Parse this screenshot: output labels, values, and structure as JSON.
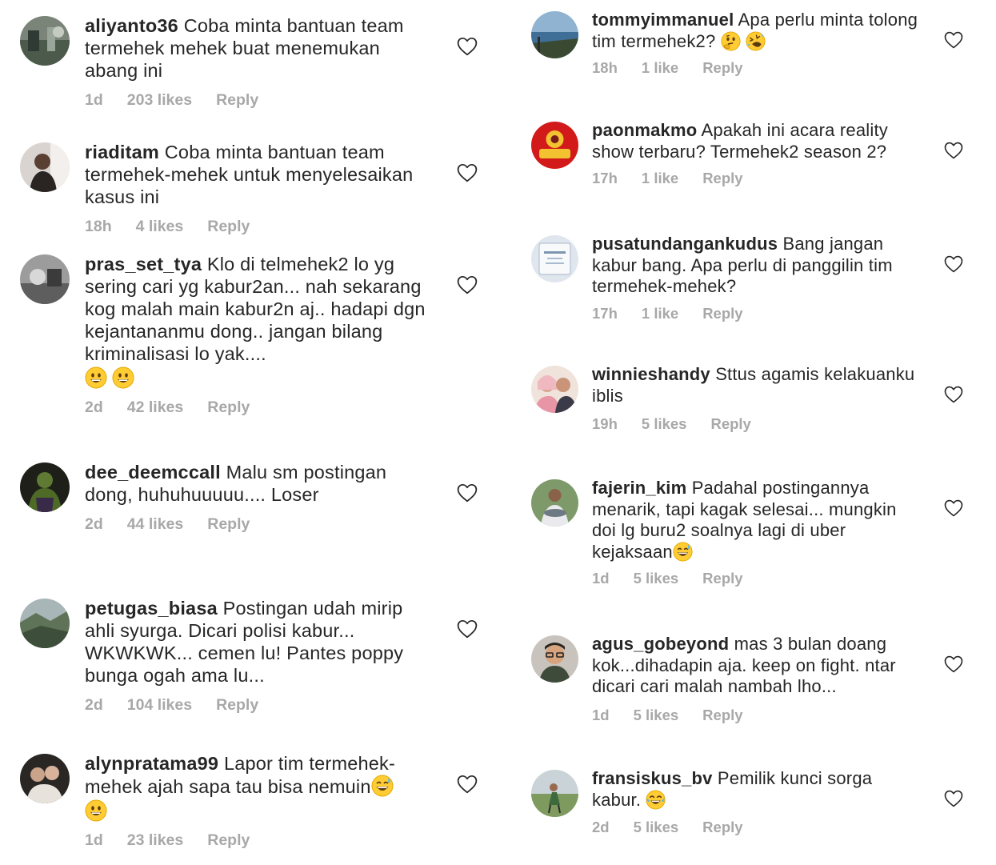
{
  "colors": {
    "text": "#262626",
    "meta": "#a8a8a8",
    "heart_stroke": "#262626",
    "emoji_fill": "#ffcc33"
  },
  "left_comments": [
    {
      "username": "aliyanto36",
      "text": "Coba minta bantuan team termehek mehek buat menemukan abang ini",
      "time": "1d",
      "likes": "203 likes",
      "reply": "Reply",
      "avatar_icon": "landscape-photo-avatar"
    },
    {
      "username": "riaditam",
      "text": "Coba minta bantuan team termehek-mehek untuk menyelesaikan kasus ini",
      "time": "18h",
      "likes": "4 likes",
      "reply": "Reply",
      "avatar_icon": "selfie-photo-avatar"
    },
    {
      "username": "pras_set_tya",
      "text": "Klo di telmehek2 lo yg sering cari yg kabur2an... nah sekarang kog malah main kabur2n aj.. hadapi dgn kejantananmu dong.. jangan bilang kriminalisasi lo yak....",
      "time": "2d",
      "likes": "42 likes",
      "reply": "Reply",
      "avatar_icon": "grayscale-photo-avatar",
      "emojis": [
        "grinning-face-emoji",
        "grinning-face-emoji"
      ]
    },
    {
      "username": "dee_deemccall",
      "text": "Malu sm postingan dong, huhuhuuuuu.... Loser",
      "time": "2d",
      "likes": "44 likes",
      "reply": "Reply",
      "avatar_icon": "hulk-figure-avatar"
    },
    {
      "username": "petugas_biasa",
      "text": "Postingan udah mirip ahli syurga. Dicari polisi kabur... WKWKWK... cemen lu! Pantes poppy bunga ogah ama lu...",
      "time": "2d",
      "likes": "104 likes",
      "reply": "Reply",
      "avatar_icon": "valley-landscape-avatar"
    },
    {
      "username": "alynpratama99",
      "text": "Lapor tim termehek-mehek ajah sapa tau bisa nemuin",
      "time": "1d",
      "likes": "23 likes",
      "reply": "Reply",
      "avatar_icon": "couple-photo-avatar",
      "inline_emoji": "grinning-sweat-emoji",
      "emojis": [
        "grinning-face-emoji"
      ]
    }
  ],
  "right_comments": [
    {
      "username": "tommyimmanuel",
      "text": "Apa perlu minta tolong tim termehek2?",
      "time": "18h",
      "likes": "1 like",
      "reply": "Reply",
      "avatar_icon": "ocean-view-avatar",
      "inline_emojis": [
        "thinking-face-emoji",
        "rolling-laughing-emoji"
      ]
    },
    {
      "username": "paonmakmo",
      "text": "Apakah ini acara reality show terbaru? Termehek2 season 2?",
      "time": "17h",
      "likes": "1 like",
      "reply": "Reply",
      "avatar_icon": "red-logo-avatar"
    },
    {
      "username": "pusatundangankudus",
      "text": "Bang jangan kabur bang. Apa perlu di panggilin tim termehek-mehek?",
      "time": "17h",
      "likes": "1 like",
      "reply": "Reply",
      "avatar_icon": "invitation-card-avatar"
    },
    {
      "username": "winnieshandy",
      "text": "Sttus agamis kelakuanku iblis",
      "time": "19h",
      "likes": "5 likes",
      "reply": "Reply",
      "avatar_icon": "couple-selfie-avatar"
    },
    {
      "username": "fajerin_kim",
      "text": "Padahal postingannya menarik, tapi kagak selesai... mungkin doi lg buru2 soalnya lagi di uber kejaksaan",
      "time": "1d",
      "likes": "5 likes",
      "reply": "Reply",
      "avatar_icon": "man-holding-fish-avatar",
      "inline_emoji": "grinning-sweat-emoji"
    },
    {
      "username": "agus_gobeyond",
      "text": "mas 3 bulan doang kok...dihadapin aja. keep on fight. ntar dicari cari malah nambah lho...",
      "time": "1d",
      "likes": "5 likes",
      "reply": "Reply",
      "avatar_icon": "man-with-glasses-avatar"
    },
    {
      "username": "fransiskus_bv",
      "text": "Pemilik kunci sorga kabur.",
      "time": "2d",
      "likes": "5 likes",
      "reply": "Reply",
      "avatar_icon": "field-photo-avatar",
      "inline_emoji": "face-with-tears-of-joy-emoji"
    }
  ]
}
